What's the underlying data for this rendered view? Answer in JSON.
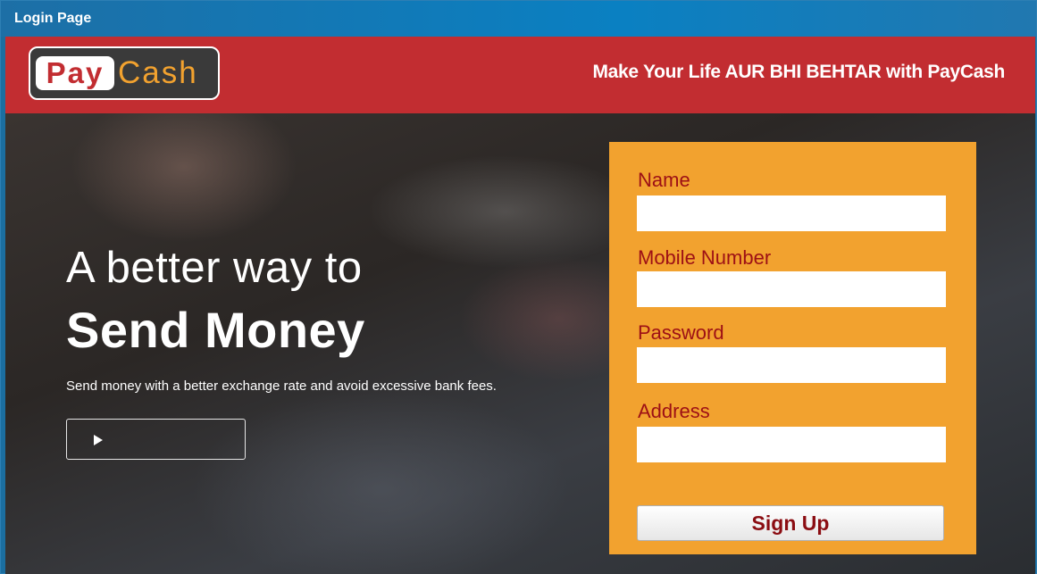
{
  "window": {
    "title": "Login Page"
  },
  "header": {
    "logo_pay": "Pay",
    "logo_cash": "Cash",
    "tagline": "Make Your Life AUR BHI BEHTAR with PayCash"
  },
  "hero": {
    "title_line1": "A better way to",
    "title_line2": "Send Money",
    "subtitle": "Send money with a better exchange rate and avoid excessive bank fees.",
    "play_icon": "play-icon"
  },
  "form": {
    "name_label": "Name",
    "name_value": "",
    "mobile_label": "Mobile Number",
    "mobile_value": "",
    "password_label": "Password",
    "password_value": "",
    "address_label": "Address",
    "address_value": "",
    "submit_label": "Sign Up"
  },
  "colors": {
    "header_red": "#c22d31",
    "form_orange": "#f2a22f",
    "label_dark_red": "#9d1015",
    "titlebar_blue": "#0a80c2"
  }
}
